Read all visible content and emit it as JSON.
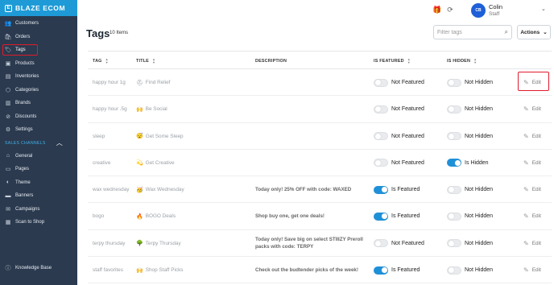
{
  "brand": {
    "name": "BLAZE ECOM",
    "accent": "#1e9bd7",
    "sidebar_bg": "#2b3a4f"
  },
  "sidebar": {
    "items": [
      {
        "label": "Customers",
        "icon": "customers-icon",
        "glyph": "👥"
      },
      {
        "label": "Orders",
        "icon": "orders-icon",
        "glyph": "🛍"
      },
      {
        "label": "Tags",
        "icon": "tag-icon",
        "glyph": "🏷",
        "active": true
      },
      {
        "label": "Products",
        "icon": "products-icon",
        "glyph": "▣"
      },
      {
        "label": "Inventories",
        "icon": "inventories-icon",
        "glyph": "▤"
      },
      {
        "label": "Categories",
        "icon": "categories-icon",
        "glyph": "⬡"
      },
      {
        "label": "Brands",
        "icon": "brands-icon",
        "glyph": "▥"
      },
      {
        "label": "Discounts",
        "icon": "discounts-icon",
        "glyph": "⊘"
      },
      {
        "label": "Settings",
        "icon": "settings-icon",
        "glyph": "⚙"
      }
    ],
    "section_label": "SALES CHANNELS",
    "channel_items": [
      {
        "label": "General",
        "icon": "general-icon",
        "glyph": "⌂"
      },
      {
        "label": "Pages",
        "icon": "pages-icon",
        "glyph": "▭"
      },
      {
        "label": "Theme",
        "icon": "theme-icon",
        "glyph": "◐"
      },
      {
        "label": "Banners",
        "icon": "banners-icon",
        "glyph": "▬"
      },
      {
        "label": "Campaigns",
        "icon": "campaigns-icon",
        "glyph": "✉"
      },
      {
        "label": "Scan to Shop",
        "icon": "scan-icon",
        "glyph": "▦"
      }
    ],
    "knowledge_base": "Knowledge Base"
  },
  "header": {
    "user": {
      "initials": "CB",
      "name": "Colin",
      "role": "Staff"
    }
  },
  "page": {
    "title": "Tags",
    "count": "10 Items",
    "filter_placeholder": "Filter tags",
    "actions_label": "Actions"
  },
  "table": {
    "columns": [
      "TAG",
      "TITLE",
      "DESCRIPTION",
      "IS FEATURED",
      "IS HIDDEN"
    ],
    "edit_label": "Edit",
    "rows": [
      {
        "tag": "happy hour 1g",
        "emoji": "⛑",
        "title": "Find Relief",
        "description": "",
        "featured": false,
        "featured_label": "Not Featured",
        "hidden": false,
        "hidden_label": "Not Hidden"
      },
      {
        "tag": "happy hour .5g",
        "emoji": "🙌",
        "title": "Be Social",
        "description": "",
        "featured": false,
        "featured_label": "Not Featured",
        "hidden": false,
        "hidden_label": "Not Hidden"
      },
      {
        "tag": "sleep",
        "emoji": "😴",
        "title": "Get Some Sleep",
        "description": "",
        "featured": false,
        "featured_label": "Not Featured",
        "hidden": false,
        "hidden_label": "Not Hidden"
      },
      {
        "tag": "creative",
        "emoji": "💫",
        "title": "Get Creative",
        "description": "",
        "featured": false,
        "featured_label": "Not Featured",
        "hidden": true,
        "hidden_label": "Is Hidden"
      },
      {
        "tag": "wax wednesday",
        "emoji": "🥳",
        "title": "Wax Wednesday",
        "description": "Today only! 25% OFF with code: WAXED",
        "featured": true,
        "featured_label": "Is Featured",
        "hidden": false,
        "hidden_label": "Not Hidden"
      },
      {
        "tag": "bogo",
        "emoji": "🔥",
        "title": "BOGO Deals",
        "description": "Shop buy one, get one deals!",
        "featured": true,
        "featured_label": "Is Featured",
        "hidden": false,
        "hidden_label": "Not Hidden"
      },
      {
        "tag": "terpy thursday",
        "emoji": "🌳",
        "title": "Terpy Thursday",
        "description": "Today only! Save big on select STIIIZY Preroll packs with code: TERPY",
        "featured": false,
        "featured_label": "Not Featured",
        "hidden": false,
        "hidden_label": "Not Hidden"
      },
      {
        "tag": "staff favorites",
        "emoji": "🙌",
        "title": "Shop Staff Picks",
        "description": "Check out the budtender picks of the week!",
        "featured": true,
        "featured_label": "Is Featured",
        "hidden": false,
        "hidden_label": "Not Hidden"
      }
    ]
  },
  "highlight_color": "#e01b2b"
}
